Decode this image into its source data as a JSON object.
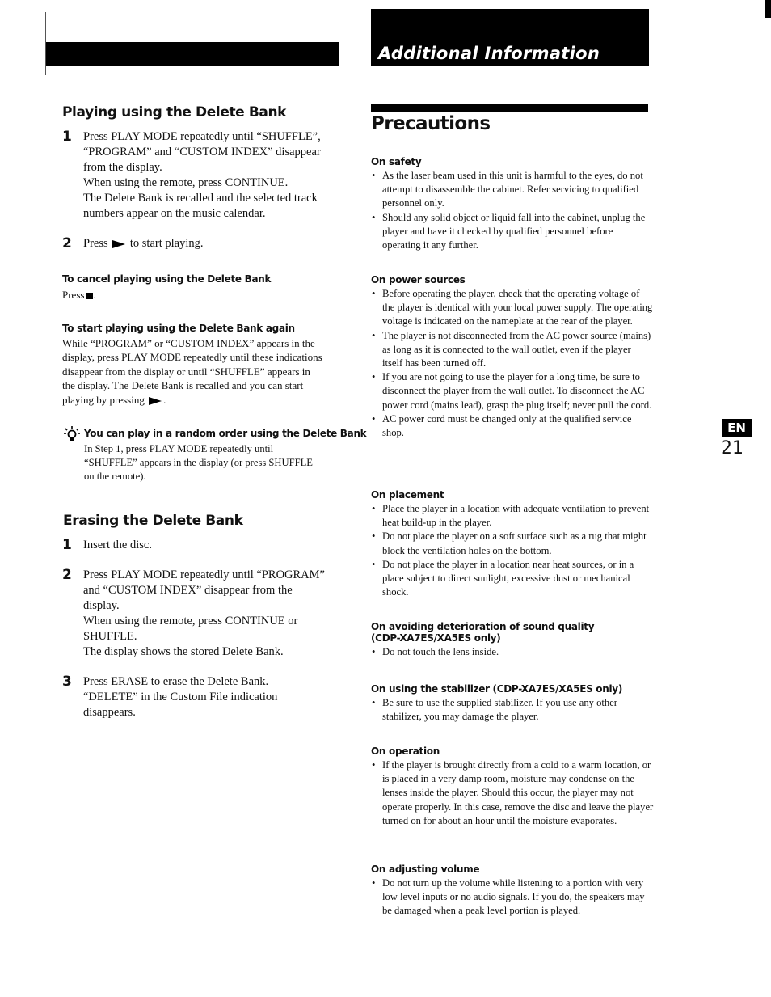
{
  "header": {
    "banner_title": "Additional Information"
  },
  "left": {
    "playing_section": {
      "title": "Playing using the Delete Bank",
      "steps": [
        {
          "num": "1",
          "lines": [
            "Press PLAY MODE repeatedly until “SHUFFLE”,",
            "“PROGRAM” and “CUSTOM INDEX” disappear",
            "from the display.",
            "When using the remote, press CONTINUE.",
            "The Delete Bank is recalled and the selected track",
            "numbers appear on the music calendar."
          ]
        },
        {
          "num": "2",
          "before": "Press",
          "icon": "play-icon",
          "after": "to start playing."
        }
      ],
      "cancel": {
        "title": "To cancel playing using the Delete Bank",
        "before": "Press",
        "icon": "stop-icon",
        "after": "."
      },
      "start_again": {
        "title": "To start playing using the Delete Bank again",
        "lines": [
          "While “PROGRAM” or “CUSTOM INDEX” appears in the",
          "display, press PLAY MODE repeatedly until these indications",
          "disappear from the display or until “SHUFFLE” appears in",
          "the display. The Delete Bank is recalled and you can start"
        ],
        "last_before": "playing by pressing",
        "last_icon": "play-icon",
        "last_after": "."
      },
      "tip": {
        "icon": "lightbulb-tip-icon",
        "title": "You can play in a random order using the Delete Bank",
        "lines": [
          "In Step 1, press PLAY MODE repeatedly until",
          "“SHUFFLE” appears in the display (or press SHUFFLE",
          "on the remote)."
        ]
      }
    },
    "erasing_section": {
      "title": "Erasing the Delete Bank",
      "steps": [
        {
          "num": "1",
          "lines": [
            "Insert the disc."
          ]
        },
        {
          "num": "2",
          "lines": [
            "Press PLAY MODE repeatedly until “PROGRAM”",
            "and “CUSTOM INDEX” disappear from the",
            "display.",
            "When using the remote, press CONTINUE or",
            "SHUFFLE.",
            "The display shows the stored Delete Bank."
          ]
        },
        {
          "num": "3",
          "lines": [
            "Press ERASE to erase the Delete Bank.",
            "“DELETE” in the Custom File indication",
            "disappears."
          ]
        }
      ]
    }
  },
  "right": {
    "title": "Precautions",
    "sections": [
      {
        "title": "On safety",
        "bullets": [
          "As the laser beam used in this unit is harmful to the eyes, do not attempt to disassemble the cabinet. Refer servicing to qualified personnel only.",
          "Should any solid object or liquid fall into the cabinet, unplug the player and have it checked by qualified personnel before operating it any further."
        ]
      },
      {
        "title": "On power sources",
        "bullets": [
          "Before operating the player, check that the operating voltage of the player is identical with your local power supply. The operating voltage is indicated on the nameplate at the rear of the player.",
          "The player is not disconnected from the AC power source (mains) as long as it is connected to the wall outlet, even if the player itself has been turned off.",
          "If you are not going to use the player for a long time, be sure to disconnect the player from the wall outlet. To disconnect the AC power cord (mains lead), grasp the plug itself; never pull the cord.",
          "AC power cord must be changed only at the qualified service shop."
        ]
      },
      {
        "title": "On placement",
        "bullets": [
          "Place the player in a location with adequate ventilation to prevent heat build-up in the player.",
          "Do not place the player on a soft surface such as a rug that might block the ventilation holes on the bottom.",
          "Do not place the player in a location near heat sources, or in a place subject to direct sunlight, excessive dust or mechanical shock."
        ]
      },
      {
        "title": "On avoiding deterioration of sound quality (CDP-XA7ES/XA5ES only)",
        "bullets": [
          "Do not touch the lens inside."
        ]
      },
      {
        "title": "On using the stabilizer (CDP-XA7ES/XA5ES only)",
        "bullets": [
          "Be sure to use the supplied stabilizer. If you use any other stabilizer, you may damage the player."
        ]
      },
      {
        "title": "On operation",
        "bullets": [
          "If the player is brought directly from a cold to a warm location, or is placed in a very damp room, moisture may condense on the lenses inside the player. Should this occur, the player may not operate properly. In this case, remove the disc and leave the player turned on for about an hour until the moisture evaporates."
        ]
      },
      {
        "title": "On adjusting volume",
        "bullets": [
          "Do not turn up the volume while listening to a portion with very low level inputs or no audio signals. If you do, the speakers may be damaged when a peak level portion is played."
        ]
      }
    ]
  },
  "side_tab": {
    "language": "EN",
    "page_number": "21"
  }
}
